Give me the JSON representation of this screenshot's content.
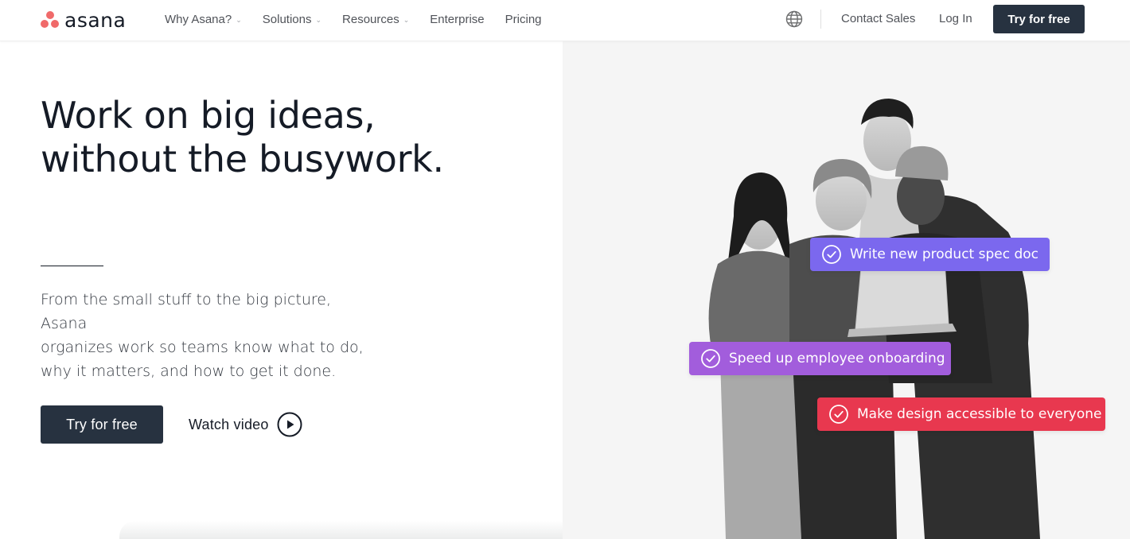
{
  "header": {
    "logo_text": "asana",
    "nav_items": [
      {
        "label": "Why Asana?",
        "has_dropdown": true
      },
      {
        "label": "Solutions",
        "has_dropdown": true
      },
      {
        "label": "Resources",
        "has_dropdown": true
      },
      {
        "label": "Enterprise",
        "has_dropdown": false
      },
      {
        "label": "Pricing",
        "has_dropdown": false
      }
    ],
    "globe_icon": "globe-icon",
    "contact_sales": "Contact Sales",
    "log_in": "Log In",
    "cta": "Try for free"
  },
  "hero": {
    "title_lines": [
      "Work on big ideas,",
      "without the busywork."
    ],
    "subtitle_lines": [
      "From the small stuff to the big picture, Asana",
      "organizes work so teams know what to do,",
      "why it matters, and how to get it done."
    ],
    "primary_cta": "Try for free",
    "watch_video": "Watch video",
    "play_icon": "play-circle-icon"
  },
  "tasks": [
    {
      "label": "Write new product spec doc",
      "color": "#7b68ee",
      "icon": "check-circle-icon"
    },
    {
      "label": "Speed up employee onboarding",
      "color": "#a25ddc",
      "icon": "check-circle-icon"
    },
    {
      "label": "Make design accessible to everyone",
      "color": "#e8384f",
      "icon": "check-circle-icon"
    }
  ],
  "colors": {
    "brand_coral": "#f06a6a",
    "button_dark": "#273240",
    "text_dark": "#151b26",
    "nav_text": "#505359",
    "hero_right_bg": "#f5f5f5"
  }
}
